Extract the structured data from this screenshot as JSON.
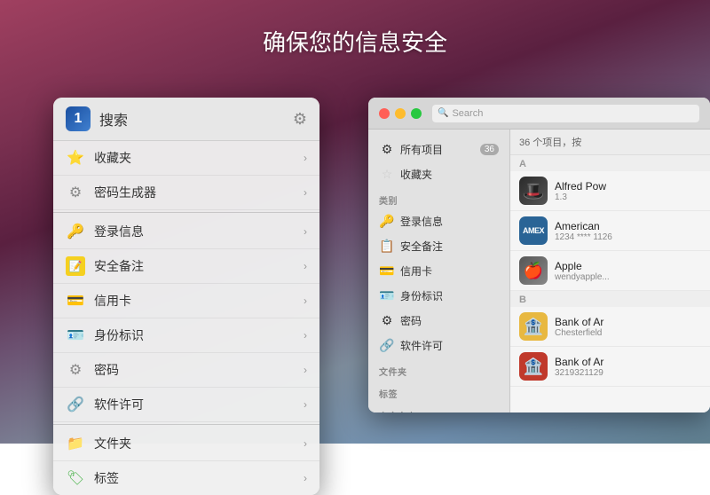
{
  "page": {
    "title": "确保您的信息安全"
  },
  "popup": {
    "logo_symbol": "1",
    "search_label": "搜索",
    "gear_symbol": "⚙",
    "items": [
      {
        "icon": "⭐",
        "label": "收藏夹",
        "has_arrow": true,
        "icon_color": "#f5a623"
      },
      {
        "icon": "⚙",
        "label": "密码生成器",
        "has_arrow": true,
        "icon_color": "#888"
      },
      {
        "divider": true
      },
      {
        "icon": "🔑",
        "label": "登录信息",
        "has_arrow": true
      },
      {
        "icon": "📝",
        "label": "安全备注",
        "has_arrow": true,
        "icon_color": "#f5d020"
      },
      {
        "icon": "💳",
        "label": "信用卡",
        "has_arrow": true,
        "icon_color": "#ccc"
      },
      {
        "icon": "🪪",
        "label": "身份标识",
        "has_arrow": true
      },
      {
        "icon": "⚙",
        "label": "密码",
        "has_arrow": true,
        "icon_color": "#888"
      },
      {
        "icon": "🔗",
        "label": "软件许可",
        "has_arrow": true
      },
      {
        "divider": true
      },
      {
        "icon": "📁",
        "label": "文件夹",
        "has_arrow": true,
        "icon_color": "#4a90d9"
      },
      {
        "icon": "🏷",
        "label": "标签",
        "has_arrow": true
      }
    ]
  },
  "app": {
    "search_placeholder": "Search",
    "traffic_lights": [
      "红色",
      "黄色",
      "绿色"
    ],
    "sidebar": {
      "all_items_label": "所有项目",
      "all_items_badge": "36",
      "favorites_label": "收藏夹",
      "section_label": "类别",
      "categories": [
        {
          "icon": "🔑",
          "label": "登录信息"
        },
        {
          "icon": "📋",
          "label": "安全备注"
        },
        {
          "icon": "💳",
          "label": "信用卡"
        },
        {
          "icon": "🪪",
          "label": "身份标识"
        },
        {
          "icon": "⚙",
          "label": "密码"
        },
        {
          "icon": "🔗",
          "label": "软件许可"
        }
      ],
      "section2_label": "文件夹",
      "section3_label": "标签",
      "section4_label": "安全审查"
    },
    "content": {
      "header_text": "36 个项目，按",
      "sections": [
        {
          "letter": "A",
          "rows": [
            {
              "name": "Alfred Pow",
              "sub": "1.3",
              "icon_type": "alfred",
              "icon_text": "🎩"
            },
            {
              "name": "American",
              "sub": "1234 **** 1126",
              "icon_type": "amex",
              "icon_text": "AMEX"
            },
            {
              "name": "Apple",
              "sub": "wendyapple...",
              "icon_type": "apple",
              "icon_text": "🍎"
            }
          ]
        },
        {
          "letter": "B",
          "rows": [
            {
              "name": "Bank of Ar",
              "sub": "Chesterfield",
              "icon_type": "bank1",
              "icon_text": "🏦"
            },
            {
              "name": "Bank of Ar",
              "sub": "3219321129",
              "icon_type": "bank2",
              "icon_text": "🏦"
            }
          ]
        }
      ]
    }
  }
}
